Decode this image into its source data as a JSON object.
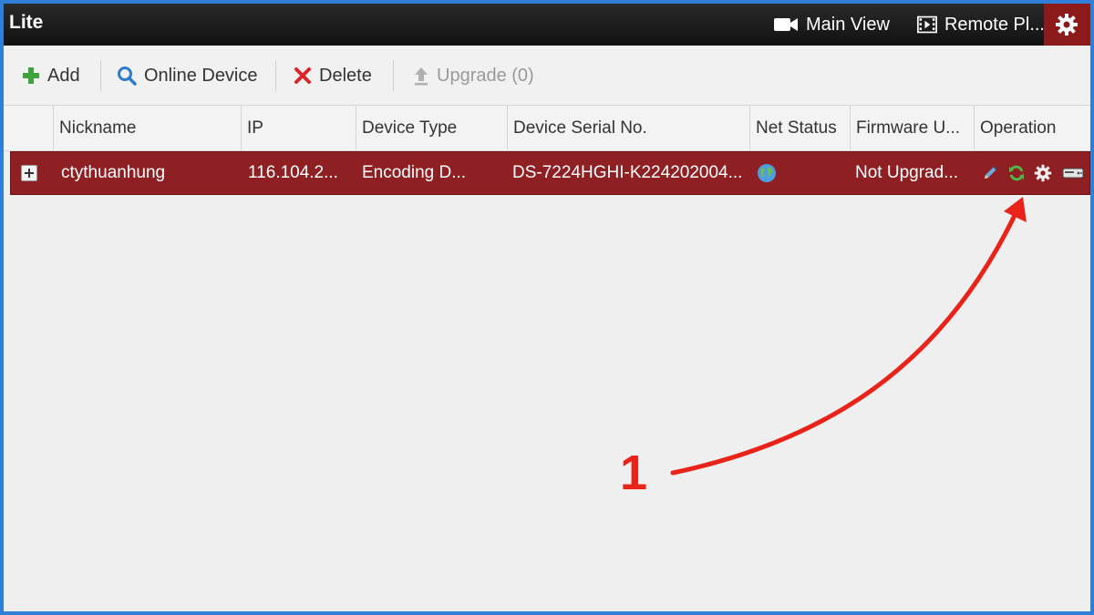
{
  "titlebar": {
    "app_title": "Lite",
    "nav": {
      "main_view": "Main View",
      "remote_playback": "Remote Pl..."
    }
  },
  "toolbar": {
    "add_label": "Add",
    "online_device_label": "Online Device",
    "delete_label": "Delete",
    "upgrade_label": "Upgrade (0)"
  },
  "table": {
    "columns": [
      "Nickname",
      "IP",
      "Device Type",
      "Device Serial No.",
      "Net Status",
      "Firmware U...",
      "Operation"
    ],
    "rows": [
      {
        "nickname": "ctythuanhung",
        "ip": "116.104.2...",
        "device_type": "Encoding D...",
        "serial": "DS-7224HGHI-K224202004...",
        "net_status_icon": "globe-icon",
        "firmware": "Not Upgrad...",
        "operations": [
          "pencil-icon",
          "refresh-icon",
          "gear-icon",
          "dvr-icon"
        ]
      }
    ]
  },
  "annotation": {
    "number": "1"
  },
  "colors": {
    "selected_row": "#8e1f22",
    "settings_tab": "#8c1a1a",
    "annotation": "#e8241a",
    "border": "#2f7fd8"
  }
}
